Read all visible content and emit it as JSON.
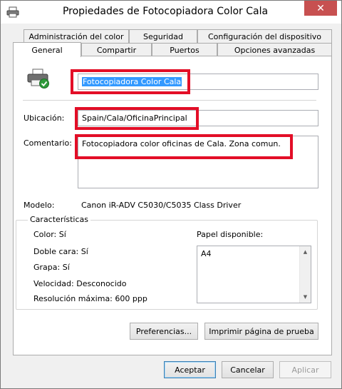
{
  "window": {
    "title": "Propiedades de Fotocopiadora Color Cala",
    "close_glyph": "✕"
  },
  "tabs_row1": [
    {
      "label": "Administración del color"
    },
    {
      "label": "Seguridad"
    },
    {
      "label": "Configuración del dispositivo"
    }
  ],
  "tabs_row2": [
    {
      "label": "General",
      "active": true
    },
    {
      "label": "Compartir"
    },
    {
      "label": "Puertos"
    },
    {
      "label": "Opciones avanzadas"
    }
  ],
  "general": {
    "printer_name": "Fotocopiadora Color Cala",
    "location_label": "Ubicación:",
    "location_value": "Spain/Cala/OficinaPrincipal",
    "comment_label": "Comentario:",
    "comment_value": "Fotocopiadora color oficinas de Cala. Zona comun.",
    "model_label": "Modelo:",
    "model_value": "Canon iR-ADV C5030/C5035 Class Driver"
  },
  "features": {
    "title": "Características",
    "color": "Color: Sí",
    "duplex": "Doble cara: Sí",
    "staple": "Grapa: Sí",
    "speed": "Velocidad: Desconocido",
    "resolution": "Resolución máxima: 600 ppp",
    "paper_label": "Papel disponible:",
    "paper_items": [
      "A4"
    ]
  },
  "buttons": {
    "preferences": "Preferencias...",
    "print_test": "Imprimir página de prueba",
    "accept": "Aceptar",
    "cancel": "Cancelar",
    "apply": "Aplicar"
  },
  "colors": {
    "highlight": "#e30e27",
    "selection": "#3399ff",
    "close": "#c75050"
  },
  "icons": {
    "app": "printer-icon",
    "printer_large": "printer-check-icon",
    "scroll_up": "chevron-up-icon",
    "scroll_down": "chevron-down-icon"
  }
}
